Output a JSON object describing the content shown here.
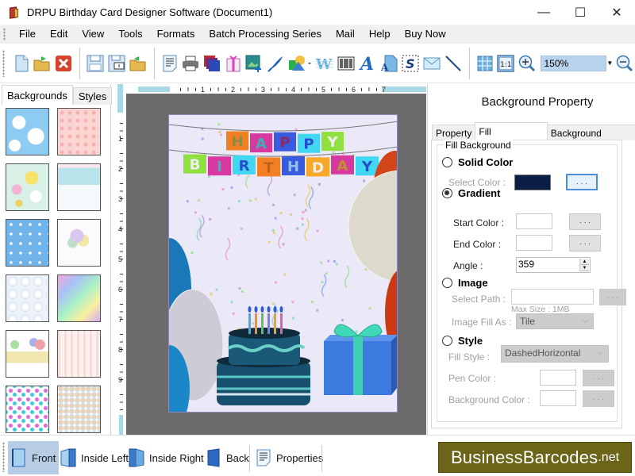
{
  "window": {
    "title": "DRPU Birthday Card Designer Software (Document1)",
    "controls": {
      "minimize": "—",
      "maximize": "☐",
      "close": "✕"
    }
  },
  "menubar": {
    "items": [
      "File",
      "Edit",
      "View",
      "Tools",
      "Formats",
      "Batch Processing Series",
      "Mail",
      "Help",
      "Buy Now"
    ]
  },
  "toolbar": {
    "icons": [
      "new-document",
      "open-folder",
      "close-document",
      "save",
      "save-as",
      "open-template",
      "properties-note",
      "print",
      "layers",
      "gift-card",
      "insert-image",
      "pen-signature",
      "shapes",
      "watermark",
      "barcode",
      "text",
      "text-document",
      "signature",
      "mail",
      "line",
      "grid",
      "actual-size",
      "zoom-in",
      "zoom-out"
    ],
    "zoom_value": "150%"
  },
  "left_panel": {
    "tabs": [
      "Backgrounds",
      "Styles"
    ],
    "active_tab": "Backgrounds",
    "thumbnails": [
      "sky-clouds",
      "pink-hearts",
      "daisy-flowers",
      "pastel-landscape",
      "blue-stars",
      "balloons",
      "bubbles",
      "rainbow-watercolor",
      "happy-birthday-balloons",
      "pink-hearts-stripes",
      "colorful-hearts",
      "balloon-bunches"
    ]
  },
  "rulers": {
    "top": [
      "1",
      "2",
      "3",
      "4",
      "5",
      "6",
      "7"
    ],
    "left": [
      "1",
      "2",
      "3",
      "4",
      "5",
      "6",
      "7",
      "8",
      "9"
    ]
  },
  "card": {
    "banner_row1": [
      "H",
      "A",
      "P",
      "P",
      "Y"
    ],
    "banner_row2": [
      "B",
      "I",
      "R",
      "T",
      "H",
      "D",
      "A",
      "Y"
    ],
    "background": "#ebe8f7"
  },
  "right_panel": {
    "title": "Background Property",
    "tabs": [
      "Property",
      "Fill Background",
      "Background Effects"
    ],
    "active_tab": "Fill Background",
    "group_label": "Fill Background",
    "solid_color": {
      "label": "Solid Color",
      "checked": false,
      "select_color_label": "Select Color :",
      "color": "#0a1e46",
      "button": ". . ."
    },
    "gradient": {
      "label": "Gradient",
      "checked": true,
      "start_color_label": "Start Color :",
      "end_color_label": "End Color :",
      "angle_label": "Angle :",
      "angle_value": "359",
      "button": ". . ."
    },
    "image": {
      "label": "Image",
      "checked": false,
      "select_path_label": "Select Path :",
      "select_path_value": "",
      "max_size": "Max Size : 1MB",
      "fill_as_label": "Image Fill As :",
      "fill_as_value": "Tile",
      "button": ". . ."
    },
    "style": {
      "label": "Style",
      "checked": false,
      "fill_style_label": "Fill Style :",
      "fill_style_value": "DashedHorizontal",
      "pen_color_label": "Pen Color :",
      "background_color_label": "Background Color :",
      "button": ". . ."
    }
  },
  "bottom_bar": {
    "buttons": [
      "Front",
      "Inside Left",
      "Inside Right",
      "Back",
      "Properties"
    ],
    "active": "Front"
  },
  "brand": {
    "main": "BusinessBarcodes",
    "suffix": ".net",
    "color": "#6b6419"
  }
}
